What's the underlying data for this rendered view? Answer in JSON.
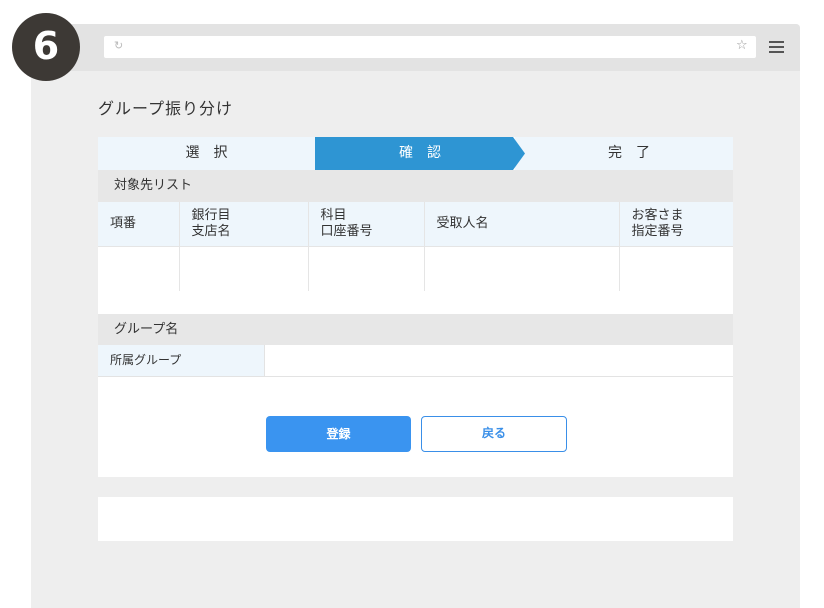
{
  "badge": {
    "number": "6"
  },
  "browser": {
    "reload_icon": "reload-icon",
    "star_icon": "star-icon",
    "menu_icon": "hamburger-menu-icon"
  },
  "page": {
    "title": "グループ振り分け"
  },
  "steps": [
    {
      "label": "選択",
      "state": "done"
    },
    {
      "label": "確認",
      "state": "active"
    },
    {
      "label": "完了",
      "state": "pending"
    }
  ],
  "colors": {
    "accent": "#2e95d3",
    "button_primary": "#3a94f0",
    "header_bg": "#e7e7e7",
    "cell_bg": "#eef6fc"
  },
  "recipient_list": {
    "heading": "対象先リスト",
    "columns": [
      {
        "line1": "項番",
        "line2": ""
      },
      {
        "line1": "銀行目",
        "line2": "支店名"
      },
      {
        "line1": "科目",
        "line2": "口座番号"
      },
      {
        "line1": "受取人名",
        "line2": ""
      },
      {
        "line1": "お客さま",
        "line2": "指定番号"
      }
    ],
    "rows": [
      [
        "",
        "",
        "",
        "",
        ""
      ]
    ]
  },
  "group": {
    "heading": "グループ名",
    "field_label": "所属グループ",
    "field_value": ""
  },
  "buttons": {
    "register": "登録",
    "back": "戻る"
  }
}
